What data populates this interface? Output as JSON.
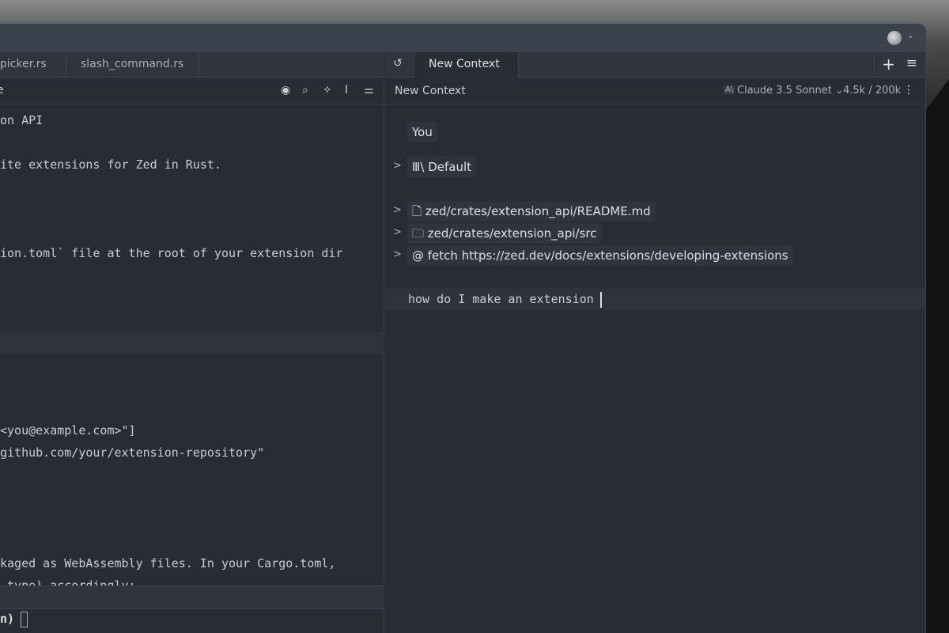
{
  "window": {
    "avatar": "user-avatar"
  },
  "tabs": [
    {
      "label": "picker.rs"
    },
    {
      "label": "slash_command.rs"
    }
  ],
  "assistant_tabs": [
    {
      "label": "New Context"
    }
  ],
  "editor": {
    "toolbar_icons": [
      "eye-icon",
      "search-icon",
      "sparkle-icon",
      "text-cursor-icon",
      "sliders-icon"
    ],
    "breadcrumb": "e",
    "lines": [
      {
        "row": 0,
        "text": "on API"
      },
      {
        "row": 2,
        "text": "ite extensions for Zed in Rust."
      },
      {
        "row": 6,
        "text": "ion.toml` file at the root of your extension dir"
      },
      {
        "row": 14,
        "text": "<you@example.com>\"]"
      },
      {
        "row": 15,
        "text": "github.com/your/extension-repository\""
      },
      {
        "row": 20,
        "text": "kaged as WebAssembly files. In your Cargo.toml,"
      },
      {
        "row": 21,
        "text": "_type) accordingly:"
      }
    ],
    "terminal": "n)"
  },
  "assistant": {
    "title": "New Context",
    "model": "Claude 3.5 Sonnet",
    "tokens": "4.5k / 200k",
    "role": "You",
    "prompt_chip": "Default",
    "context_items": [
      {
        "icon": "file-icon",
        "label": "zed/crates/extension_api/README.md"
      },
      {
        "icon": "folder-icon",
        "label": "zed/crates/extension_api/src"
      },
      {
        "icon": "at-icon",
        "label": "fetch https://zed.dev/docs/extensions/developing-extensions"
      }
    ],
    "input": "how do I make an extension"
  }
}
